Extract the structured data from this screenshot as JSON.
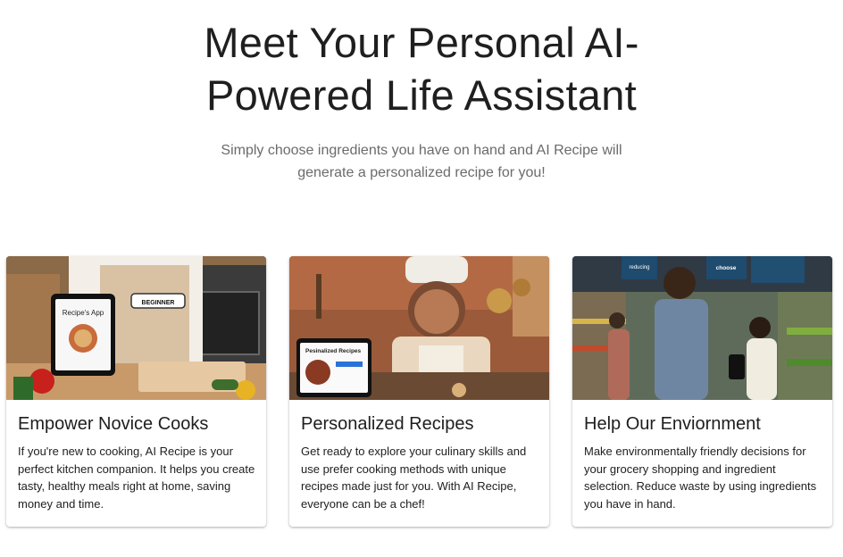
{
  "hero": {
    "title": "Meet Your Personal AI-Powered Life Assistant",
    "subtitle": "Simply choose ingredients you have on hand and AI Recipe will generate a personalized recipe for you!"
  },
  "cards": [
    {
      "title": "Empower Novice Cooks",
      "text": "If you're new to cooking, AI Recipe is your perfect kitchen companion. It helps you create tasty, healthy meals right at home, saving money and time.",
      "image_labels": {
        "badge": "BEGINNER",
        "tablet": "Recipe's App"
      }
    },
    {
      "title": "Personalized Recipes",
      "text": "Get ready to explore your culinary skills and use prefer cooking methods with unique recipes made just for you. With AI Recipe, everyone can be a chef!",
      "image_labels": {
        "tablet": "Pesinalized Recipes"
      }
    },
    {
      "title": "Help Our Enviornment",
      "text": "Make environmentally friendly decisions for your grocery shopping and ingredient selection. Reduce waste by using ingredients you have in hand.",
      "image_labels": {
        "sign_left": "reducing",
        "sign_right": "choose"
      }
    }
  ]
}
